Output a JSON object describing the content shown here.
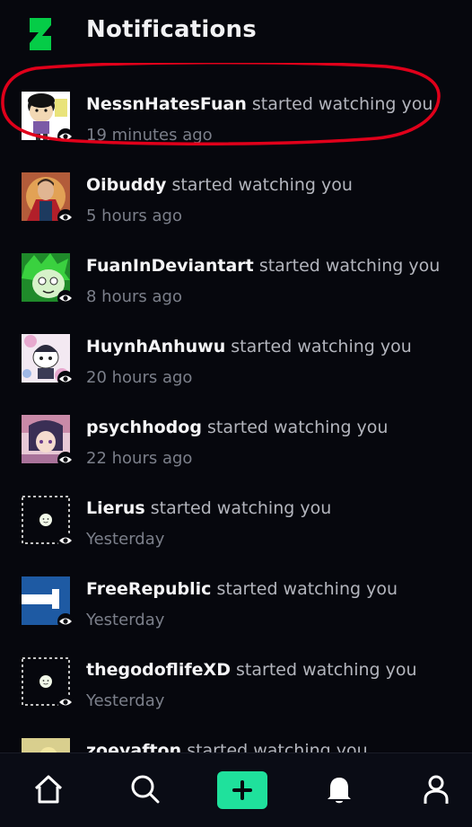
{
  "header": {
    "title": "Notifications",
    "logo_icon": "deviantart-logo-icon",
    "brand_color": "#05cc47"
  },
  "notifications": [
    {
      "username": "NessnHatesFuan",
      "action": "started watching you",
      "time": "19 minutes ago",
      "avatar": "cartoon-character",
      "highlighted": true
    },
    {
      "username": "Oibuddy",
      "action": "started watching you",
      "time": "5 hours ago",
      "avatar": "red-caped-figure"
    },
    {
      "username": "FuanInDeviantart",
      "action": "started watching you",
      "time": "8 hours ago",
      "avatar": "green-character"
    },
    {
      "username": "HuynhAnhuwu",
      "action": "started watching you",
      "time": "20 hours ago",
      "avatar": "white-character"
    },
    {
      "username": "psychhodog",
      "action": "started watching you",
      "time": "22 hours ago",
      "avatar": "anime-art"
    },
    {
      "username": "Lierus",
      "action": "started watching you",
      "time": "Yesterday",
      "avatar": "default-avatar"
    },
    {
      "username": "FreeRepublic",
      "action": "started watching you",
      "time": "Yesterday",
      "avatar": "blue-flag"
    },
    {
      "username": "thegodoflifeXD",
      "action": "started watching you",
      "time": "Yesterday",
      "avatar": "default-avatar"
    },
    {
      "username": "zoeyafton",
      "action": "started watching you",
      "time": "",
      "avatar": "partial-avatar"
    }
  ],
  "bottom_nav": {
    "items": [
      "home-icon",
      "search-icon",
      "create-plus-icon",
      "bell-icon",
      "profile-icon"
    ],
    "active": "bell-icon",
    "accent": "#1fe19c"
  },
  "annotation": {
    "color": "#e0001a",
    "shape": "hand-drawn ellipse"
  }
}
